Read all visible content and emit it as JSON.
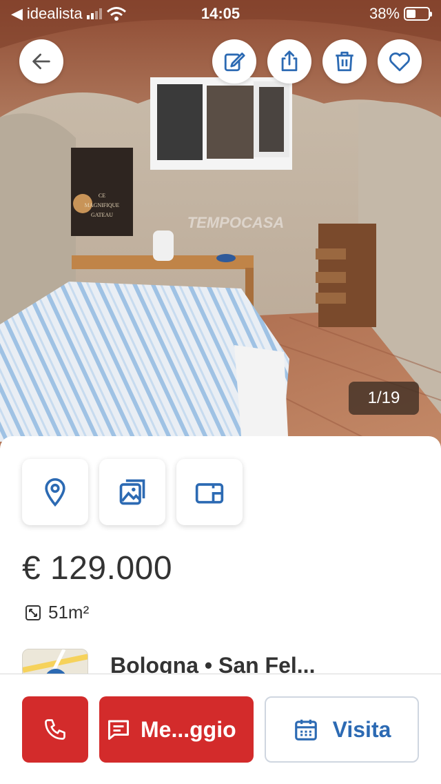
{
  "status_bar": {
    "back_app": "idealista",
    "time": "14:05",
    "battery": "38%"
  },
  "colors": {
    "accent_red": "#d32b2b",
    "accent_blue": "#2c6ab3"
  },
  "photo": {
    "counter": "1/19",
    "poster_text_line1": "CE",
    "poster_text_line2": "MAGNIFIQUE",
    "poster_text_line3": "GATEAU",
    "watermark": "TEMPOCASA"
  },
  "top_actions": {
    "icons": [
      "back-arrow-icon",
      "edit-icon",
      "share-icon",
      "trash-icon",
      "heart-icon"
    ]
  },
  "listing": {
    "tiles": [
      "location-pin-icon",
      "gallery-icon",
      "floorplan-icon"
    ],
    "price": "€ 129.000",
    "area": "51m²",
    "location": "Bologna • San Fel..."
  },
  "actions": {
    "message_label": "Me...ggio",
    "visit_label": "Visita"
  }
}
